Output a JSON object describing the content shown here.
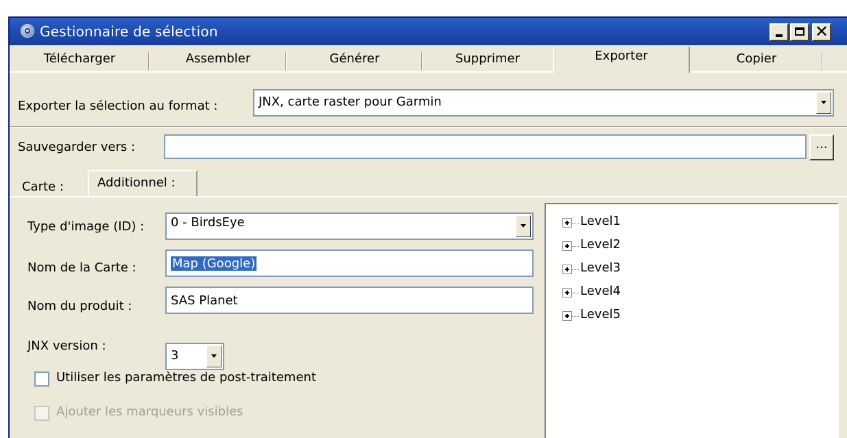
{
  "window": {
    "title": "Gestionnaire de sélection"
  },
  "tabs": [
    {
      "label": "Télécharger"
    },
    {
      "label": "Assembler"
    },
    {
      "label": "Générer"
    },
    {
      "label": "Supprimer"
    },
    {
      "label": "Exporter",
      "active": true
    },
    {
      "label": "Copier"
    }
  ],
  "export": {
    "format_label": "Exporter la sélection au format :",
    "format_value": "JNX, carte raster pour Garmin",
    "save_label": "Sauvegarder vers :",
    "save_value": "",
    "browse_label": "..."
  },
  "subtabs": [
    {
      "label": "Carte :"
    },
    {
      "label": "Additionnel :",
      "active": true
    }
  ],
  "form": {
    "type_label": "Type d'image (ID) :",
    "type_value": "0 - BirdsEye",
    "map_name_label": "Nom de la Carte :",
    "map_name_value": "Map (Google)",
    "product_label": "Nom du produit :",
    "product_value": "SAS Planet",
    "jnx_label": "JNX version :",
    "jnx_value": "3",
    "post_processing_label": "Utiliser les paramètres de post-traitement",
    "post_processing_checked": false,
    "markers_label": "Ajouter les marqueurs visibles",
    "markers_checked": false,
    "markers_enabled": false
  },
  "tree": [
    {
      "label": "Level1"
    },
    {
      "label": "Level2"
    },
    {
      "label": "Level3"
    },
    {
      "label": "Level4"
    },
    {
      "label": "Level5"
    }
  ],
  "colors": {
    "titlebar": "#1f4eb3",
    "face": "#ece9d8",
    "selection": "#316ac5",
    "input_border": "#7f9db9"
  }
}
